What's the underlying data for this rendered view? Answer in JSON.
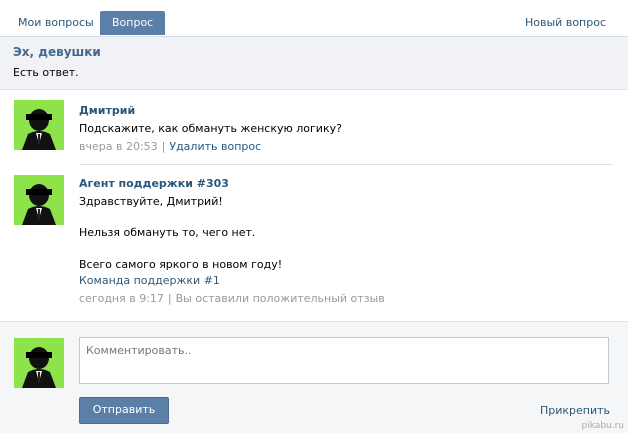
{
  "tabs": {
    "my_questions": "Мои вопросы",
    "question": "Вопрос",
    "new_question": "Новый вопрос"
  },
  "question": {
    "title": "Эх, девушки",
    "status": "Есть ответ."
  },
  "posts": [
    {
      "author": "Дмитрий",
      "lines": [
        "Подскажите, как обмануть женскую логику?"
      ],
      "time": "вчера в 20:53",
      "action": "Удалить вопрос"
    },
    {
      "author": "Агент поддержки #303",
      "lines": [
        "Здравствуйте, Дмитрий!",
        "Нельзя обмануть то, чего нет.",
        "Всего самого яркого в новом году!"
      ],
      "signature": "Команда поддержки #1",
      "time": "сегодня в 9:17",
      "action": "Вы оставили положительный отзыв"
    }
  ],
  "reply": {
    "placeholder": "Комментировать..",
    "send_label": "Отправить",
    "attach_label": "Прикрепить"
  },
  "watermark": "pikabu.ru",
  "colors": {
    "accent": "#5b7fa6",
    "link": "#2b587a",
    "avatar_bg": "#8fe34a"
  }
}
